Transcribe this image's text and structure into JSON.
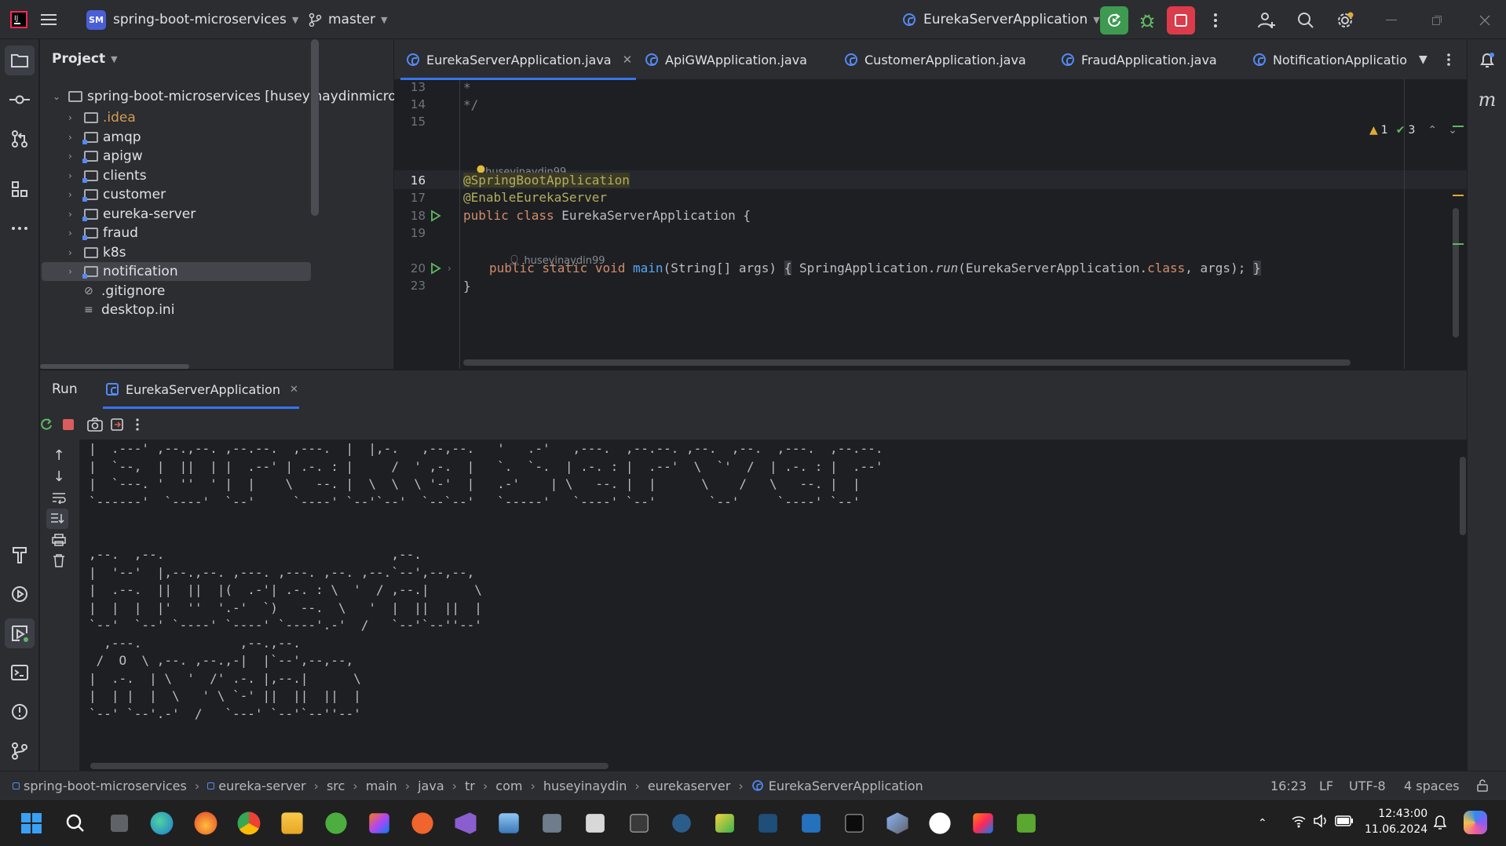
{
  "titlebar": {
    "project_badge": "SM",
    "project_name": "spring-boot-microservices",
    "branch": "master",
    "run_config": "EurekaServerApplication"
  },
  "project_panel": {
    "title": "Project",
    "root": "spring-boot-microservices [huseyinaydinmicros",
    "items": [
      {
        "label": ".idea",
        "type": "folder",
        "color": "#d49a57"
      },
      {
        "label": "amqp",
        "type": "module"
      },
      {
        "label": "apigw",
        "type": "module"
      },
      {
        "label": "clients",
        "type": "module"
      },
      {
        "label": "customer",
        "type": "module"
      },
      {
        "label": "eureka-server",
        "type": "module"
      },
      {
        "label": "fraud",
        "type": "module"
      },
      {
        "label": "k8s",
        "type": "folder"
      },
      {
        "label": "notification",
        "type": "module",
        "selected": true
      },
      {
        "label": ".gitignore",
        "type": "file"
      },
      {
        "label": "desktop.ini",
        "type": "file"
      }
    ]
  },
  "editor": {
    "tabs": [
      {
        "label": "EurekaServerApplication.java",
        "active": true
      },
      {
        "label": "ApiGWApplication.java"
      },
      {
        "label": "CustomerApplication.java"
      },
      {
        "label": "FraudApplication.java"
      },
      {
        "label": "NotificationApplicatio"
      }
    ],
    "inspection": {
      "warnings": "1",
      "checks": "3"
    },
    "line_numbers": [
      "13",
      "14",
      "15",
      "16",
      "17",
      "18",
      "19",
      "20",
      "23"
    ],
    "lines": {
      "l13": "*",
      "l14": "*/",
      "author1": "huseyinaydin99",
      "l16": "@SpringBootApplication",
      "l17": "@EnableEurekaServer",
      "l18_kw": "public class ",
      "l18_name": "EurekaServerApplication {",
      "author2": "huseyinaydin99",
      "l20_kw": "public static void ",
      "l20_main": "main",
      "l20_params": "(String[] args) ",
      "l20_open": "{",
      "l20_body1": " SpringApplication.",
      "l20_run": "run",
      "l20_body2": "(EurekaServerApplication.",
      "l20_class": "class",
      "l20_body3": ", args); ",
      "l20_close": "}",
      "l23": "}"
    }
  },
  "run": {
    "title": "Run",
    "tab": "EurekaServerApplication",
    "console": [
      "|  .---' ,--.,--. ,--.--.  ,---.  |  |,-.   ,--,--.   '   .-'   ,---.  ,--.--. ,--.  ,--.  ,---.  ,--.--.",
      "|  `--,  |  ||  | |  .--' | .-. : |     /  ' ,-.  |   `.  `-.  | .-. : |  .--'  \\  `'  /  | .-. : |  .--'",
      "|  `---. '  ''  ' |  |    \\   --. |  \\  \\  \\ '-'  |   .-'    | \\   --. |  |      \\    /   \\   --. |  |",
      "`------'  `----'  `--'     `----' `--'`--'  `--`--'   `-----'   `----' `--'       `--'     `----' `--'",
      "",
      "",
      ",--.  ,--.                              ,--.",
      "|  '--'  |,--.,--. ,---. ,---. ,--. ,--.`--',--,--,",
      "|  .--.  ||  ||  |(  .-'| .-. : \\  '  / ,--.|      \\",
      "|  |  |  |'  ''  '.-'  `)   --.  \\   '  |  ||  ||  |",
      "`--'  `--' `----' `----' `----'.-'  /   `--'`--''--'",
      "  ,---.             ,--.,--.",
      " /  O  \\ ,--. ,--.,-|  |`--',--,--,",
      "|  .-.  | \\  '  /' .-. |,--.|      \\",
      "|  | |  |  \\   ' \\ `-' ||  ||  ||  |",
      "`--' `--'.-'  /   `---' `--'`--''--'"
    ]
  },
  "statusbar": {
    "breadcrumbs": [
      "spring-boot-microservices",
      "eureka-server",
      "src",
      "main",
      "java",
      "tr",
      "com",
      "huseyinaydin",
      "eurekaserver",
      "EurekaServerApplication"
    ],
    "position": "16:23",
    "line_ending": "LF",
    "encoding": "UTF-8",
    "indent": "4 spaces"
  },
  "taskbar": {
    "time": "12:43:00",
    "date": "11.06.2024"
  },
  "colors": {
    "keyword": "#cf8e6d",
    "annotation": "#b3ae60",
    "method": "#56a8f5",
    "accent": "#3574f0"
  }
}
